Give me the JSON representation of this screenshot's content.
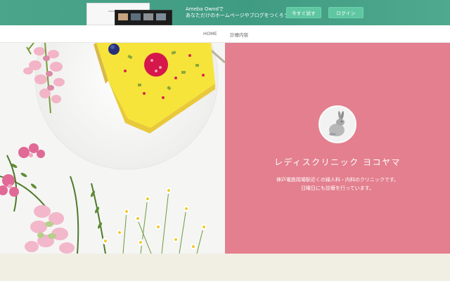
{
  "promo": {
    "brand_line": "Ameba Owndで",
    "tagline": "あなただけのホームページやブログをつくろう",
    "try_label": "今すぐ試す",
    "login_label": "ログイン",
    "colors": {
      "banner": "#3f9b82",
      "button": "#5fc6a2"
    }
  },
  "nav": {
    "items": [
      {
        "label": "HOME"
      },
      {
        "label": "診療内容"
      }
    ]
  },
  "hero": {
    "clinic_name": "レディスクリニック ヨコヤマ",
    "description_line1": "神戸電鉄岡場駅近くの婦人科・内科のクリニックです。",
    "description_line2": "日曜日にも診療を行っています。",
    "avatar_icon": "rabbit-icon",
    "colors": {
      "panel": "#e37f8e",
      "background": "#f1efe4"
    }
  }
}
